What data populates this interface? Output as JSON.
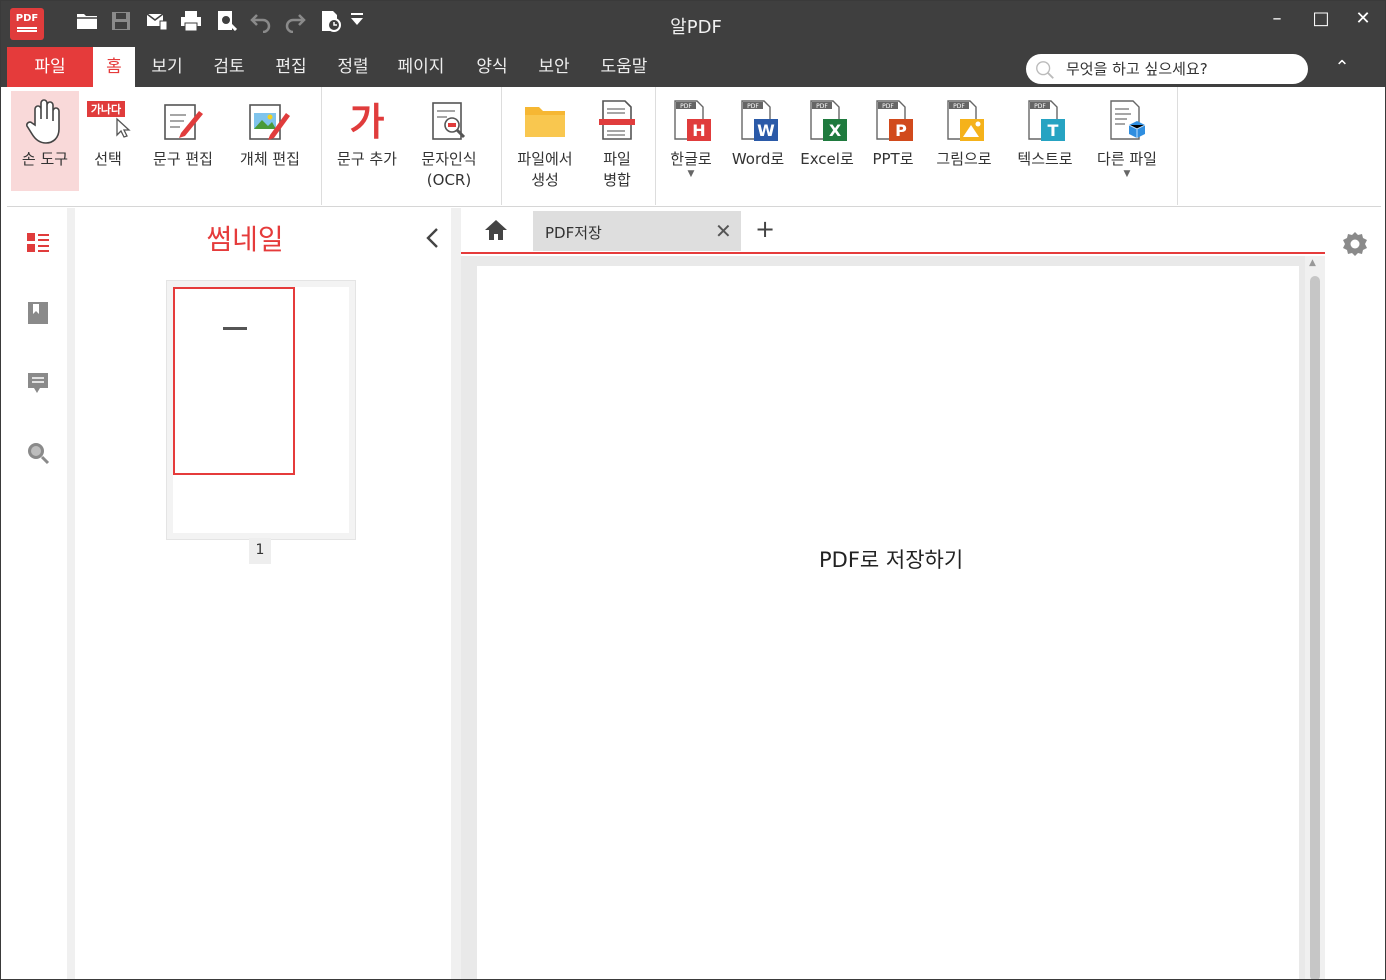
{
  "app": {
    "logo_text": "PDF",
    "window_title": "알PDF"
  },
  "quick_access": [
    "open-folder-icon",
    "save-icon",
    "email-icon",
    "print-icon",
    "print-preview-icon",
    "undo-icon",
    "redo-icon",
    "recent-file-icon",
    "customize-dropdown-icon"
  ],
  "window_controls": {
    "minimize": "–",
    "maximize": "□",
    "close": "✕"
  },
  "menu": {
    "tabs": [
      "파일",
      "홈",
      "보기",
      "검토",
      "편집",
      "정렬",
      "페이지",
      "양식",
      "보안",
      "도움말"
    ],
    "active": "홈",
    "search_placeholder": "무엇을 하고 싶으세요?",
    "collapse_glyph": "⌃"
  },
  "ribbon": {
    "hand_tool": "손 도구",
    "select_badge": "가나다",
    "select": "선택",
    "edit_text": "문구 편집",
    "edit_object": "개체 편집",
    "add_text_glyph": "가",
    "add_text": "문구 추가",
    "ocr_line1": "문자인식",
    "ocr_line2": "(OCR)",
    "from_file_line1": "파일에서",
    "from_file_line2": "생성",
    "merge_line1": "파일",
    "merge_line2": "병합",
    "to_hwp": "한글로",
    "to_word": "Word로",
    "to_excel": "Excel로",
    "to_ppt": "PPT로",
    "to_image": "그림으로",
    "to_text": "텍스트로",
    "to_other": "다른 파일",
    "dropdown_glyph": "▼",
    "pdf_badge": "PDF",
    "hwp_letter": "H",
    "word_letter": "W",
    "excel_letter": "X",
    "ppt_letter": "P",
    "text_letter": "T",
    "colors": {
      "hwp": "#e03c3c",
      "word": "#2b5aa8",
      "excel": "#1f7a3e",
      "ppt": "#d14a1c",
      "image": "#f5b21a",
      "text": "#26a3c2",
      "other": "#2f8ee0"
    }
  },
  "thumbnail_panel": {
    "title": "썸네일",
    "pages": [
      {
        "number": "1"
      }
    ]
  },
  "document": {
    "tab_label": "PDF저장",
    "tab_close": "✕",
    "add_tab": "+",
    "page_text": "PDF로 저장하기"
  },
  "theme": {
    "accent": "#e53b3b",
    "chrome": "#3f3f3f"
  }
}
